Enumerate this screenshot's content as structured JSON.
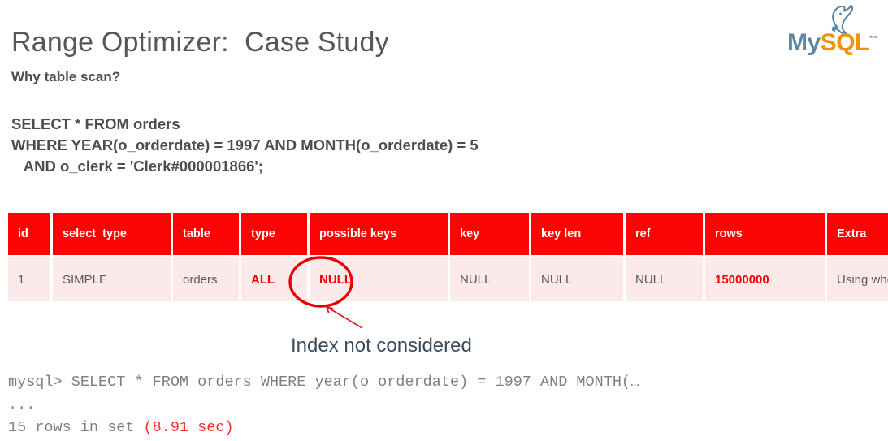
{
  "slide": {
    "title": "Range Optimizer:  Case Study",
    "subtitle": "Why table scan?"
  },
  "logo": {
    "icon": "dolphin-icon",
    "my": "My",
    "sql": "SQL",
    "tm": "™",
    "color_my": "#5d87a1",
    "color_sql": "#f29111"
  },
  "sql_query": {
    "line1": "SELECT * FROM orders",
    "line2": "WHERE YEAR(o_orderdate) = 1997 AND MONTH(o_orderdate) = 5",
    "line3": "   AND o_clerk = 'Clerk#000001866';"
  },
  "explain_table": {
    "headers": [
      "id",
      "select  type",
      "table",
      "type",
      "possible keys",
      "key",
      "key len",
      "ref",
      "rows",
      "Extra"
    ],
    "rows": [
      {
        "id": "1",
        "select_type": "SIMPLE",
        "table": "orders",
        "type": "ALL",
        "possible_keys": "NULL",
        "key": "NULL",
        "key_len": "NULL",
        "ref": "NULL",
        "rows": "15000000",
        "extra": "Using where"
      }
    ],
    "header_bg": "#fc0404",
    "row_bg": "#fce9e9",
    "emphasis_color": "#f40000"
  },
  "annotation": {
    "label": "Index not considered",
    "color": "#e02020",
    "label_color": "#3b4d5c"
  },
  "terminal": {
    "line1": "mysql> SELECT * FROM orders WHERE year(o_orderdate) = 1997 AND MONTH(…",
    "line2": "...",
    "line3_prefix": "15 rows in set ",
    "line3_time": "(8.91 sec)"
  }
}
